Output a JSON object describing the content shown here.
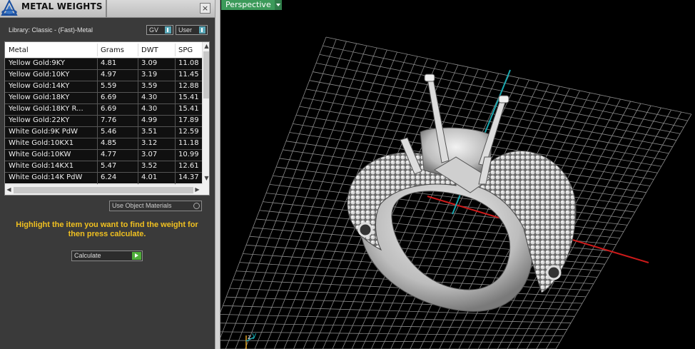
{
  "panel": {
    "title": "METAL WEIGHTS",
    "close_glyph": "×",
    "library_label": "Library: Classic - (Fast)-Metal",
    "gv_label": "GV",
    "user_label": "User",
    "use_object_materials_label": "Use Object Materials",
    "hint_text": "Highlight the item you want to find the weight for then press calculate.",
    "calculate_label": "Calculate"
  },
  "table": {
    "headers": [
      "Metal",
      "Grams",
      "DWT",
      "SPG"
    ],
    "rows": [
      [
        "Yellow Gold:9KY",
        "4.81",
        "3.09",
        "11.08"
      ],
      [
        "Yellow Gold:10KY",
        "4.97",
        "3.19",
        "11.45"
      ],
      [
        "Yellow Gold:14KY",
        "5.59",
        "3.59",
        "12.88"
      ],
      [
        "Yellow Gold:18KY",
        "6.69",
        "4.30",
        "15.41"
      ],
      [
        "Yellow Gold:18KY R...",
        "6.69",
        "4.30",
        "15.41"
      ],
      [
        "Yellow Gold:22KY",
        "7.76",
        "4.99",
        "17.89"
      ],
      [
        "White Gold:9K PdW",
        "5.46",
        "3.51",
        "12.59"
      ],
      [
        "White Gold:10KX1",
        "4.85",
        "3.12",
        "11.18"
      ],
      [
        "White Gold:10KW",
        "4.77",
        "3.07",
        "10.99"
      ],
      [
        "White Gold:14KX1",
        "5.47",
        "3.52",
        "12.61"
      ],
      [
        "White Gold:14K PdW",
        "6.24",
        "4.01",
        "14.37"
      ]
    ]
  },
  "viewport": {
    "view_name": "Perspective",
    "axis_z": "z",
    "axis_y": "y"
  },
  "colors": {
    "accent_green": "#3c9a5a",
    "hint_yellow": "#f0c020",
    "axis_red": "#cc1a1a",
    "axis_cyan": "#1aa8b0",
    "grid": "#8a8a8a"
  }
}
